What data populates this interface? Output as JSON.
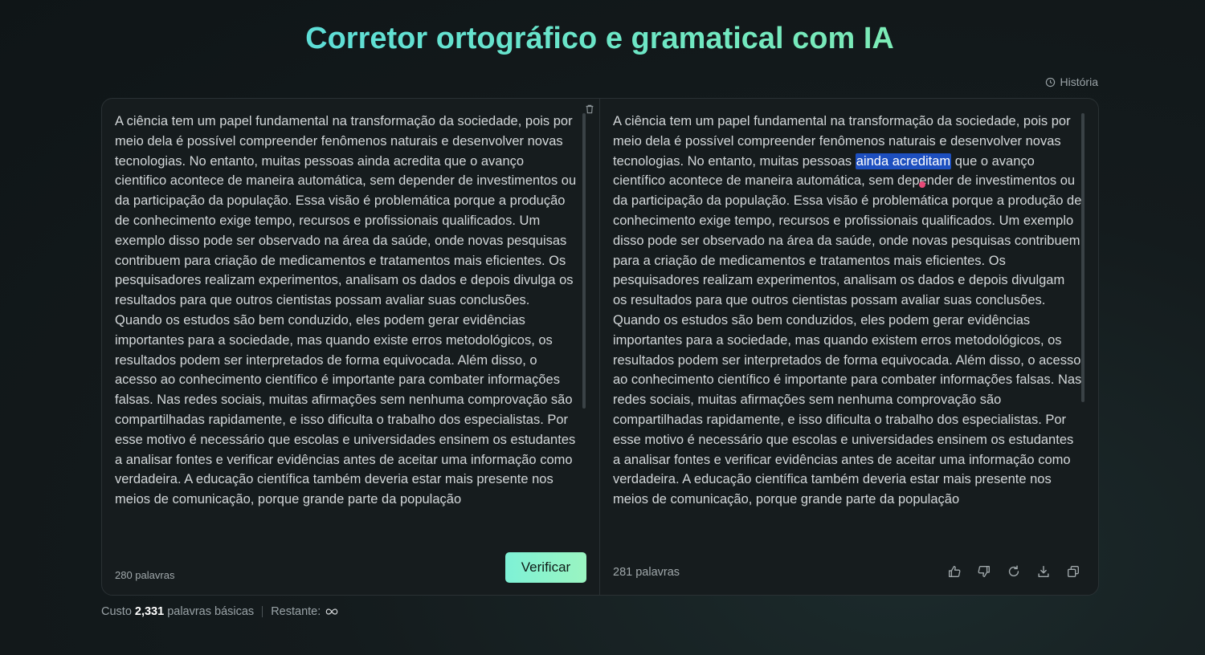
{
  "header": {
    "title": "Corretor ortográfico e gramatical com IA",
    "history_label": "História"
  },
  "icons": {
    "history": "clock-icon",
    "trash": "trash-icon",
    "like": "thumbs-up-icon",
    "dislike": "thumbs-down-icon",
    "regenerate": "refresh-icon",
    "download": "download-icon",
    "copy": "copy-icon",
    "infinity": "infinity-icon"
  },
  "colors": {
    "title_gradient_start": "#4fd6e8",
    "title_gradient_end": "#8ff0a4",
    "verify_button": "#8ff3cc",
    "highlight": "#1d4fbf",
    "pin": "#e84a78"
  },
  "input_panel": {
    "text": "A ciência tem um papel fundamental na transformação da sociedade, pois por meio dela é possível compreender fenômenos naturais e desenvolver novas tecnologias. No entanto, muitas pessoas ainda acredita que o avanço cientifico acontece de maneira automática, sem depender de investimentos ou da participação da população. Essa visão é problemática porque a produção de conhecimento exige tempo, recursos e profissionais qualificados. Um exemplo disso pode ser observado na área da saúde, onde novas pesquisas contribuem para criação de medicamentos e tratamentos mais eficientes. Os pesquisadores realizam experimentos, analisam os dados e depois divulga os resultados para que outros cientistas possam avaliar suas conclusões. Quando os estudos são bem conduzido, eles podem gerar evidências importantes para a sociedade, mas quando existe erros metodológicos, os resultados podem ser interpretados de forma equivocada. Além disso, o acesso ao conhecimento científico é importante para combater informações falsas. Nas redes sociais, muitas afirmações sem nenhuma comprovação são compartilhadas rapidamente, e isso dificulta o trabalho dos especialistas. Por esse motivo é necessário que escolas e universidades ensinem os estudantes a analisar fontes e verificar evidências antes de aceitar uma informação como verdadeira. A educação científica também deveria estar mais presente nos meios de comunicação, porque grande parte da população",
    "word_count": "280 palavras",
    "verify_label": "Verificar"
  },
  "output_panel": {
    "text_before": "A ciência tem um papel fundamental na transformação da sociedade, pois por meio dela é possível compreender fenômenos naturais e desenvolver novas tecnologias. No entanto, muitas pessoas ",
    "highlight": "ainda acreditam",
    "text_mid_1": " que o avanço científico acontece de maneira automática, sem depe",
    "text_mid_2": "nder de investimentos ou da participação da população. Essa visão é problemática porque a produção de conhecimento exige tempo, recursos e profissionais qualificados. Um exemplo disso pode ser observado na área da saúde, onde novas pesquisas contribuem para a criação de medicamentos e tratamentos mais eficientes. Os pesquisadores realizam experimentos, analisam os dados e depois divulgam os resultados para que outros cientistas possam avaliar suas conclusões. Quando os estudos são bem conduzidos, eles podem gerar evidências importantes para a sociedade, mas quando existem erros metodológicos, os resultados podem ser interpretados de forma equivocada. Além disso, o acesso ao conhecimento científico é importante para combater informações falsas. Nas redes sociais, muitas afirmações sem nenhuma comprovação são compartilhadas rapidamente, e isso dificulta o trabalho dos especialistas. Por esse motivo é necessário que escolas e universidades ensinem os estudantes a analisar fontes e verificar evidências antes de aceitar uma informação como verdadeira. A educação científica também deveria estar mais presente nos meios de comunicação, porque grande parte da população",
    "word_count": "281 palavras"
  },
  "footer": {
    "cost_prefix": "Custo",
    "cost_value": "2,331",
    "cost_suffix": "palavras básicas",
    "remaining_label": "Restante:"
  }
}
